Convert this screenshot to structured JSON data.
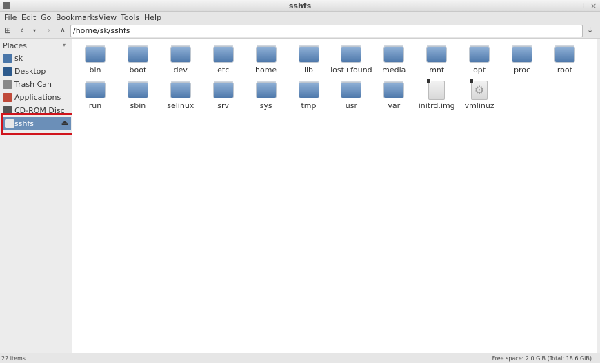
{
  "window": {
    "title": "sshfs",
    "controls": [
      "−",
      "+",
      "×"
    ]
  },
  "menu": [
    "File",
    "Edit",
    "Go",
    "Bookmarks",
    "View",
    "Tools",
    "Help"
  ],
  "toolbar": {
    "path": "/home/sk/sshfs"
  },
  "sidebar": {
    "header": "Places",
    "items": [
      {
        "label": "sk",
        "icon": "home-icon",
        "color": "#4a76a8"
      },
      {
        "label": "Desktop",
        "icon": "desktop-icon",
        "color": "#2d5a8c"
      },
      {
        "label": "Trash Can",
        "icon": "trash-icon",
        "color": "#888888"
      },
      {
        "label": "Applications",
        "icon": "applications-icon",
        "color": "#c04a3a"
      },
      {
        "label": "CD-ROM Disc",
        "icon": "cdrom-icon",
        "color": "#555555"
      },
      {
        "label": "sshfs",
        "icon": "drive-icon",
        "color": "#e8e8e8"
      }
    ]
  },
  "files": [
    {
      "name": "bin",
      "type": "folder"
    },
    {
      "name": "boot",
      "type": "folder"
    },
    {
      "name": "dev",
      "type": "folder"
    },
    {
      "name": "etc",
      "type": "folder"
    },
    {
      "name": "home",
      "type": "folder"
    },
    {
      "name": "lib",
      "type": "folder"
    },
    {
      "name": "lost+found",
      "type": "folder"
    },
    {
      "name": "media",
      "type": "folder"
    },
    {
      "name": "mnt",
      "type": "folder"
    },
    {
      "name": "opt",
      "type": "folder"
    },
    {
      "name": "proc",
      "type": "folder"
    },
    {
      "name": "root",
      "type": "folder"
    },
    {
      "name": "run",
      "type": "folder"
    },
    {
      "name": "sbin",
      "type": "folder"
    },
    {
      "name": "selinux",
      "type": "folder"
    },
    {
      "name": "srv",
      "type": "folder"
    },
    {
      "name": "sys",
      "type": "folder"
    },
    {
      "name": "tmp",
      "type": "folder"
    },
    {
      "name": "usr",
      "type": "folder"
    },
    {
      "name": "var",
      "type": "folder"
    },
    {
      "name": "initrd.img",
      "type": "link"
    },
    {
      "name": "vmlinuz",
      "type": "link-exec"
    }
  ],
  "status": {
    "count": "22 items",
    "free": "Free space: 2.0 GiB (Total: 18.6 GiB)"
  }
}
